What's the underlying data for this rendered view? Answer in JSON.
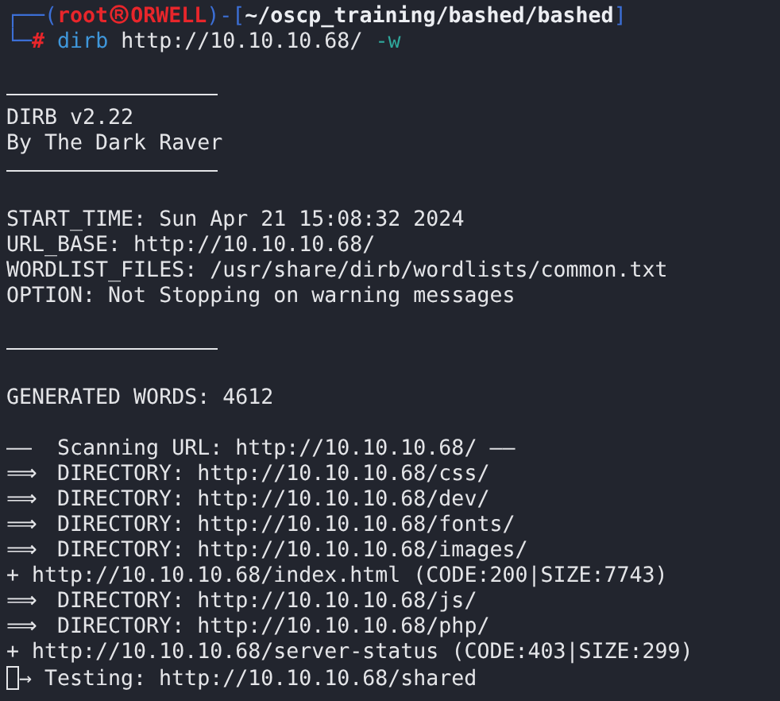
{
  "prompt": {
    "corner_top": "┌──(",
    "user": "root",
    "host": "ORWELL",
    "path_open": ")-[",
    "path": "~/oscp_training/bashed/bashed",
    "path_close": "]",
    "corner_bottom": "└─",
    "prompt_char": "#",
    "command": "dirb",
    "argument": "http://10.10.10.68/",
    "option": "-w"
  },
  "blocks": [
    [
      {
        "kind": "rule"
      },
      {
        "kind": "text",
        "text": "DIRB v2.22"
      },
      {
        "kind": "text",
        "text": "By The Dark Raver"
      },
      {
        "kind": "rule"
      }
    ],
    [
      {
        "kind": "text",
        "text": "START_TIME: Sun Apr 21 15:08:32 2024"
      },
      {
        "kind": "text",
        "text": "URL_BASE: http://10.10.10.68/"
      },
      {
        "kind": "text",
        "text": "WORDLIST_FILES: /usr/share/dirb/wordlists/common.txt"
      },
      {
        "kind": "text",
        "text": "OPTION: Not Stopping on warning messages"
      }
    ],
    [
      {
        "kind": "rule"
      }
    ],
    [
      {
        "kind": "text",
        "text": "GENERATED WORDS: 4612"
      }
    ],
    [
      {
        "kind": "header",
        "marker": "——",
        "text": "Scanning URL: http://10.10.10.68/"
      },
      {
        "kind": "directory",
        "marker": "⟹",
        "text": "DIRECTORY: http://10.10.10.68/css/"
      },
      {
        "kind": "directory",
        "marker": "⟹",
        "text": "DIRECTORY: http://10.10.10.68/dev/"
      },
      {
        "kind": "directory",
        "marker": "⟹",
        "text": "DIRECTORY: http://10.10.10.68/fonts/"
      },
      {
        "kind": "directory",
        "marker": "⟹",
        "text": "DIRECTORY: http://10.10.10.68/images/"
      },
      {
        "kind": "text",
        "text": "+ http://10.10.10.68/index.html (CODE:200|SIZE:7743)"
      },
      {
        "kind": "directory",
        "marker": "⟹",
        "text": "DIRECTORY: http://10.10.10.68/js/"
      },
      {
        "kind": "directory",
        "marker": "⟹",
        "text": "DIRECTORY: http://10.10.10.68/php/"
      },
      {
        "kind": "text",
        "text": "+ http://10.10.10.68/server-status (CODE:403|SIZE:299)"
      },
      {
        "kind": "progress",
        "marker": "→",
        "text": "Testing: http://10.10.10.68/shared"
      }
    ]
  ]
}
